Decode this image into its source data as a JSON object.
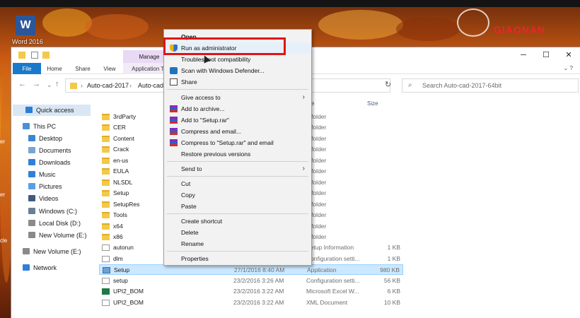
{
  "desktop": {
    "word_label": "Word 2016",
    "word_icon_letter": "W",
    "logo_text": "GIAONAN",
    "edge_labels": [
      "er",
      "er",
      "cle"
    ]
  },
  "window": {
    "manage_tab": "Manage",
    "ribbon_tabs": [
      "File",
      "Home",
      "Share",
      "View",
      "Application To"
    ],
    "controls": {
      "minimize": "─",
      "maximize": "☐",
      "close": "✕"
    },
    "help_ctl": "⌄  ?"
  },
  "address": {
    "back": "←",
    "forward": "→",
    "dropdown": "⌄",
    "up": "↑",
    "crumbs": [
      "Auto-cad-2017",
      "Auto-cad-"
    ],
    "refresh": "↻",
    "search_placeholder": "Search Auto-cad-2017-64bit"
  },
  "nav": [
    {
      "label": "Quick access",
      "icon": "star-icon",
      "color": "#2a7fd4"
    },
    {
      "label": "This PC",
      "icon": "pc-icon",
      "color": "#4a90d9"
    },
    {
      "label": "Desktop",
      "icon": "desktop-icon",
      "color": "#3a86d0"
    },
    {
      "label": "Documents",
      "icon": "documents-icon",
      "color": "#7aa5d0"
    },
    {
      "label": "Downloads",
      "icon": "downloads-icon",
      "color": "#2f80d8"
    },
    {
      "label": "Music",
      "icon": "music-icon",
      "color": "#2f80d8"
    },
    {
      "label": "Pictures",
      "icon": "pictures-icon",
      "color": "#5aa0e0"
    },
    {
      "label": "Videos",
      "icon": "videos-icon",
      "color": "#405a80"
    },
    {
      "label": "Windows (C:)",
      "icon": "drive-icon",
      "color": "#6a7f96"
    },
    {
      "label": "Local Disk (D:)",
      "icon": "drive-icon",
      "color": "#8a8a8a"
    },
    {
      "label": "New Volume (E:)",
      "icon": "drive-icon",
      "color": "#8a8a8a"
    },
    {
      "label": "New Volume (E:)",
      "icon": "drive-icon",
      "color": "#8a8a8a"
    },
    {
      "label": "Network",
      "icon": "network-icon",
      "color": "#2f80d8"
    }
  ],
  "columns": {
    "type": "e",
    "size": "Size"
  },
  "files": [
    {
      "name": "3rdParty",
      "date": "",
      "type": "e folder",
      "size": "",
      "kind": "folder"
    },
    {
      "name": "CER",
      "date": "",
      "type": "e folder",
      "size": "",
      "kind": "folder"
    },
    {
      "name": "Content",
      "date": "",
      "type": "e folder",
      "size": "",
      "kind": "folder"
    },
    {
      "name": "Crack",
      "date": "",
      "type": "e folder",
      "size": "",
      "kind": "folder"
    },
    {
      "name": "en-us",
      "date": "",
      "type": "e folder",
      "size": "",
      "kind": "folder"
    },
    {
      "name": "EULA",
      "date": "",
      "type": "e folder",
      "size": "",
      "kind": "folder"
    },
    {
      "name": "NLSDL",
      "date": "",
      "type": "e folder",
      "size": "",
      "kind": "folder"
    },
    {
      "name": "Setup",
      "date": "",
      "type": "e folder",
      "size": "",
      "kind": "folder"
    },
    {
      "name": "SetupRes",
      "date": "",
      "type": "e folder",
      "size": "",
      "kind": "folder"
    },
    {
      "name": "Tools",
      "date": "",
      "type": "e folder",
      "size": "",
      "kind": "folder"
    },
    {
      "name": "x64",
      "date": "",
      "type": "e folder",
      "size": "",
      "kind": "folder"
    },
    {
      "name": "x86",
      "date": "",
      "type": "e folder",
      "size": "",
      "kind": "folder"
    },
    {
      "name": "autorun",
      "date": "",
      "type": "Setup Information",
      "size": "1 KB",
      "kind": "doc"
    },
    {
      "name": "dlm",
      "date": "",
      "type": "Configuration setti...",
      "size": "1 KB",
      "kind": "doc"
    },
    {
      "name": "Setup",
      "date": "27/1/2016 8:40 AM",
      "type": "Application",
      "size": "980 KB",
      "kind": "app"
    },
    {
      "name": "setup",
      "date": "23/2/2016 3:26 AM",
      "type": "Configuration setti...",
      "size": "56 KB",
      "kind": "doc"
    },
    {
      "name": "UPI2_BOM",
      "date": "23/2/2016 3:22 AM",
      "type": "Microsoft Excel W...",
      "size": "6 KB",
      "kind": "xls"
    },
    {
      "name": "UPI2_BOM",
      "date": "23/2/2016 3:22 AM",
      "type": "XML Document",
      "size": "10 KB",
      "kind": "doc"
    }
  ],
  "context_menu": {
    "open": "Open",
    "run_as_admin": "Run as administrator",
    "troubleshoot": "Troubleshoot compatibility",
    "defender": "Scan with Windows Defender...",
    "share": "Share",
    "give_access": "Give access to",
    "add_archive": "Add to archive...",
    "add_setup_rar": "Add to \"Setup.rar\"",
    "compress_email": "Compress and email...",
    "compress_setup_email": "Compress to \"Setup.rar\" and email",
    "restore": "Restore previous versions",
    "send_to": "Send to",
    "cut": "Cut",
    "copy": "Copy",
    "paste": "Paste",
    "create_shortcut": "Create shortcut",
    "delete": "Delete",
    "rename": "Rename",
    "properties": "Properties",
    "submenu_arrow": "›"
  }
}
